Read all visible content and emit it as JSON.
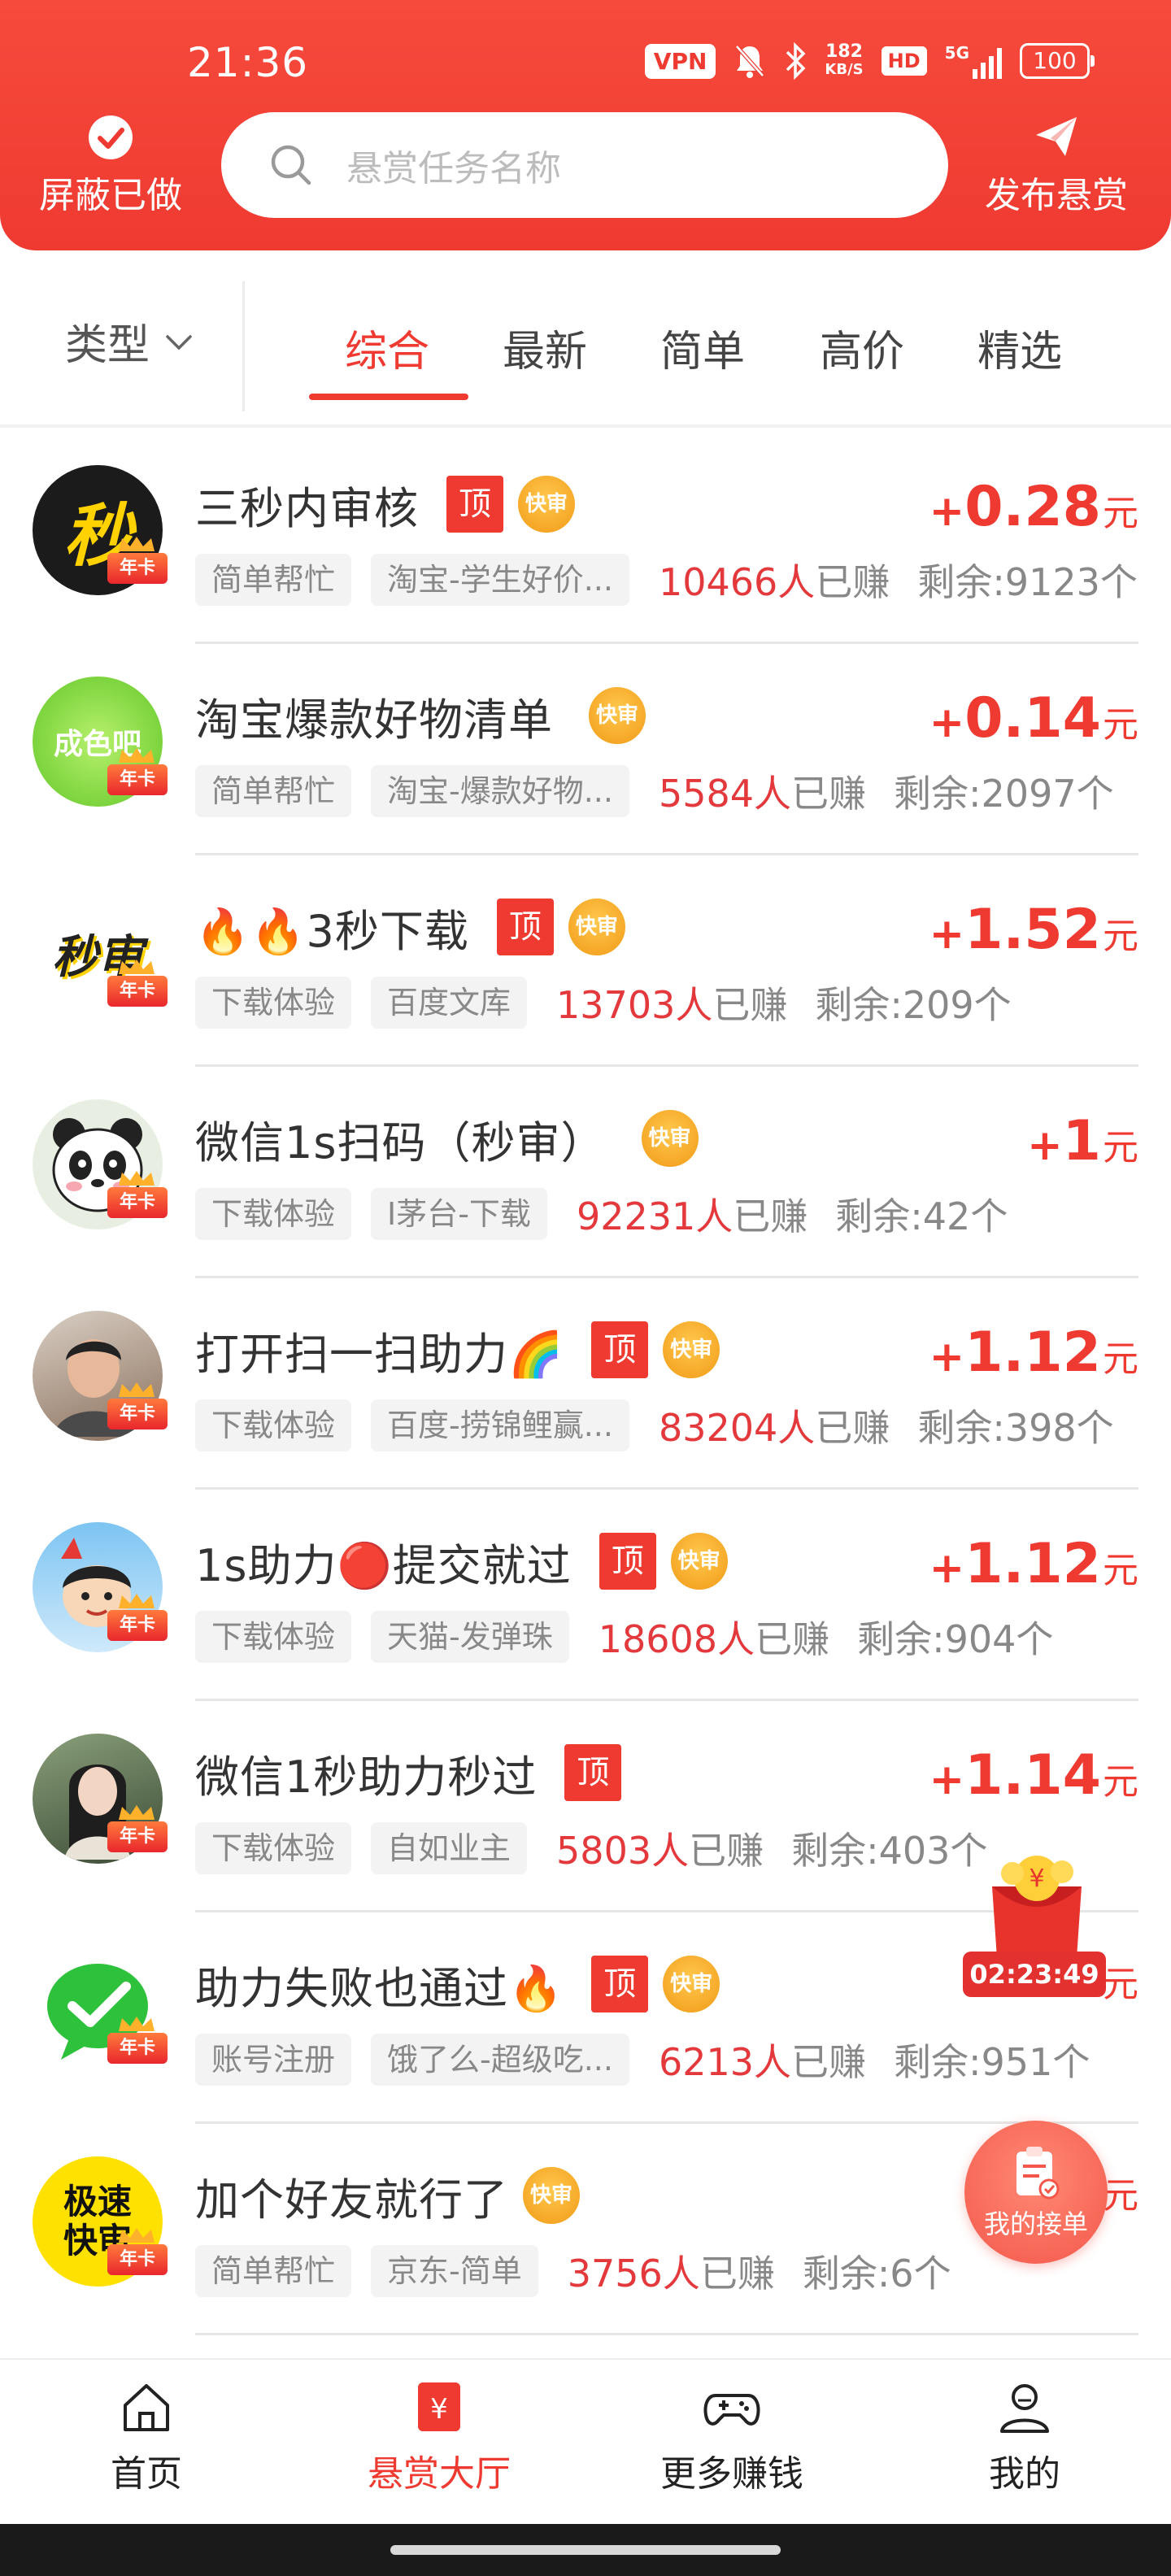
{
  "status_bar": {
    "time": "21:36",
    "vpn": "VPN",
    "speed_value": "182",
    "speed_unit": "KB/S",
    "hd": "HD",
    "network": "5G",
    "battery": "100"
  },
  "header": {
    "shield_label": "屏蔽已做",
    "search_placeholder": "悬赏任务名称",
    "publish_label": "发布悬赏",
    "brand_color": "#ef3a31"
  },
  "filters": {
    "type_label": "类型",
    "tabs": [
      "综合",
      "最新",
      "简单",
      "高价",
      "精选"
    ],
    "active_tab": "综合"
  },
  "tasks": [
    {
      "title": "三秒内审核",
      "top": true,
      "fast": true,
      "reward_plus": "+",
      "reward": "0.28",
      "unit": "元",
      "tags": [
        "简单帮忙",
        "淘宝-学生好价..."
      ],
      "earned": "10466人",
      "earned_suffix": "已赚",
      "remaining": "剩余:9123个",
      "avatar": "秒"
    },
    {
      "title": "淘宝爆款好物清单",
      "top": false,
      "fast": true,
      "reward_plus": "+",
      "reward": "0.14",
      "unit": "元",
      "tags": [
        "简单帮忙",
        "淘宝-爆款好物..."
      ],
      "earned": "5584人",
      "earned_suffix": "已赚",
      "remaining": "剩余:2097个",
      "avatar": "成色吧"
    },
    {
      "title": "🔥🔥3秒下载",
      "top": true,
      "fast": true,
      "reward_plus": "+",
      "reward": "1.52",
      "unit": "元",
      "tags": [
        "下载体验",
        "百度文库"
      ],
      "earned": "13703人",
      "earned_suffix": "已赚",
      "remaining": "剩余:209个",
      "avatar": "秒审"
    },
    {
      "title": "微信1s扫码（秒审）",
      "top": false,
      "fast": true,
      "reward_plus": "+",
      "reward": "1",
      "unit": "元",
      "tags": [
        "下载体验",
        "I茅台-下载"
      ],
      "earned": "92231人",
      "earned_suffix": "已赚",
      "remaining": "剩余:42个",
      "avatar": "panda"
    },
    {
      "title": "打开扫一扫助力🌈",
      "top": true,
      "fast": true,
      "reward_plus": "+",
      "reward": "1.12",
      "unit": "元",
      "tags": [
        "下载体验",
        "百度-捞锦鲤赢..."
      ],
      "earned": "83204人",
      "earned_suffix": "已赚",
      "remaining": "剩余:398个",
      "avatar": "person"
    },
    {
      "title": "1s助力🔴提交就过",
      "top": true,
      "fast": true,
      "reward_plus": "+",
      "reward": "1.12",
      "unit": "元",
      "tags": [
        "下载体验",
        "天猫-发弹珠"
      ],
      "earned": "18608人",
      "earned_suffix": "已赚",
      "remaining": "剩余:904个",
      "avatar": "cartoon"
    },
    {
      "title": "微信1秒助力秒过",
      "top": true,
      "fast": false,
      "reward_plus": "+",
      "reward": "1.14",
      "unit": "元",
      "tags": [
        "下载体验",
        "自如业主"
      ],
      "earned": "5803人",
      "earned_suffix": "已赚",
      "remaining": "剩余:403个",
      "avatar": "girl"
    },
    {
      "title": "助力失败也通过🔥",
      "top": true,
      "fast": true,
      "reward_plus": "+",
      "reward": "",
      "unit": "元",
      "tags": [
        "账号注册",
        "饿了么-超级吃..."
      ],
      "earned": "6213人",
      "earned_suffix": "已赚",
      "remaining": "剩余:951个",
      "avatar": "wechat"
    },
    {
      "title": "加个好友就行了",
      "top": false,
      "fast": true,
      "reward_plus": "",
      "reward": "",
      "unit": "元",
      "tags": [
        "简单帮忙",
        "京东-简单"
      ],
      "earned": "3756人",
      "earned_suffix": "已赚",
      "remaining": "剩余:6个",
      "avatar": "极速快审"
    }
  ],
  "badges": {
    "top_label": "顶",
    "fast_label": "快审",
    "year_label": "年卡"
  },
  "floating": {
    "countdown": "02:23:49",
    "my_orders": "我的接单"
  },
  "bottom_nav": [
    {
      "label": "首页",
      "icon": "home-icon"
    },
    {
      "label": "悬赏大厅",
      "icon": "reward-hall-icon",
      "active": true
    },
    {
      "label": "更多赚钱",
      "icon": "gamepad-icon"
    },
    {
      "label": "我的",
      "icon": "user-icon"
    }
  ]
}
